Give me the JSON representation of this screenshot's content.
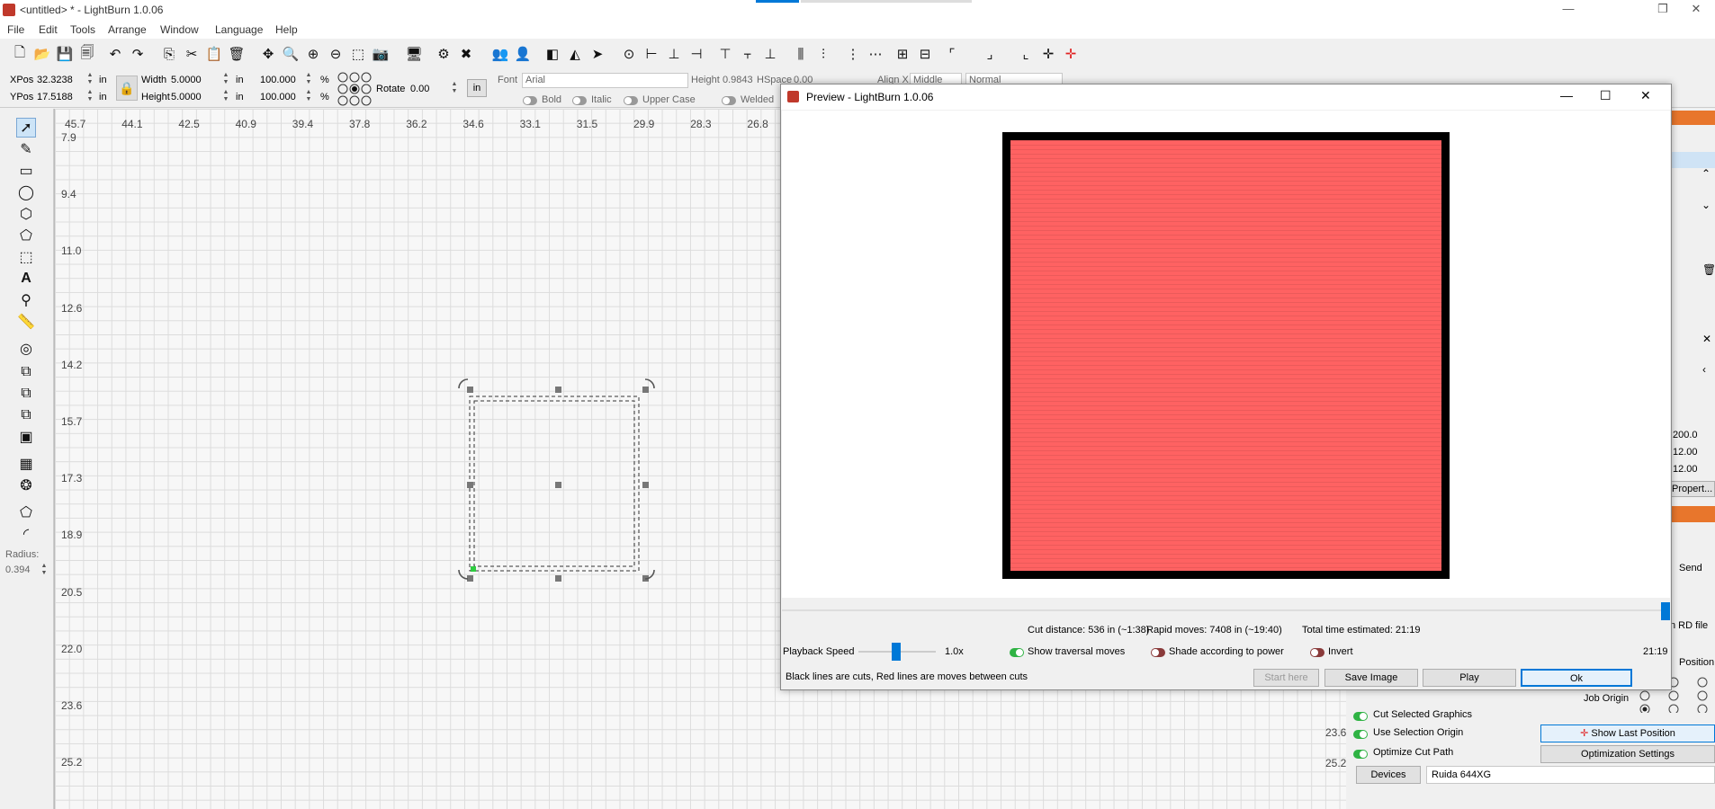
{
  "window": {
    "title": "<untitled> * - LightBurn 1.0.06",
    "minimize": "—",
    "restore": "❐",
    "close": "✕"
  },
  "menu": [
    "File",
    "Edit",
    "Tools",
    "Arrange",
    "Window",
    "Language",
    "Help"
  ],
  "props": {
    "xpos_label": "XPos",
    "xpos": "32.3238",
    "ypos_label": "YPos",
    "ypos": "17.5188",
    "unit": "in",
    "width_label": "Width",
    "width": "5.0000",
    "height_label": "Height",
    "height": "5.0000",
    "scale_w": "100.000",
    "scale_h": "100.000",
    "pct": "%",
    "rotate_label": "Rotate",
    "rotate": "0.00",
    "rotate_unit": "in",
    "font_label": "Font",
    "font": "Arial",
    "fheight_label": "Height",
    "fheight": "0.9843",
    "hspace_label": "HSpace",
    "hspace": "0.00",
    "alignx_label": "Align X",
    "alignx": "Middle",
    "normal": "Normal",
    "bold": "Bold",
    "italic": "Italic",
    "upper": "Upper Case",
    "welded": "Welded"
  },
  "radius": {
    "label": "Radius:",
    "value": "0.394"
  },
  "ruler_x": [
    "45.7",
    "44.1",
    "42.5",
    "40.9",
    "39.4",
    "37.8",
    "36.2",
    "34.6",
    "33.1",
    "31.5",
    "29.9",
    "28.3",
    "26.8"
  ],
  "ruler_y": [
    "7.9",
    "9.4",
    "11.0",
    "12.6",
    "14.2",
    "15.7",
    "17.3",
    "18.9",
    "20.5",
    "22.0",
    "23.6",
    "25.2"
  ],
  "ruler_y_right": [
    "23.6",
    "25.2"
  ],
  "preview": {
    "title": "Preview - LightBurn 1.0.06",
    "cut_distance": "Cut distance: 536 in (~1:38)",
    "rapid_moves": "Rapid moves: 7408 in (~19:40)",
    "total_time": "Total time estimated: 21:19",
    "playback_label": "Playback Speed",
    "speed": "1.0x",
    "traversal": "Show traversal moves",
    "shade": "Shade according to power",
    "invert": "Invert",
    "time": "21:19",
    "legend": "Black lines are cuts, Red lines are moves between cuts",
    "start_here": "Start here",
    "save_image": "Save Image",
    "play": "Play",
    "ok": "Ok",
    "progress": 1.0
  },
  "right": {
    "v1": "200.0",
    "v2": "12.00",
    "v3": "12.00",
    "properties": "Propert...",
    "send": "Send",
    "rd_file": "n RD file",
    "position": "Position",
    "job_origin": "Job Origin",
    "cut_selected": "Cut Selected Graphics",
    "use_selection": "Use Selection Origin",
    "optimize": "Optimize Cut Path",
    "show_last": "Show Last Position",
    "opt_settings": "Optimization Settings",
    "devices": "Devices",
    "device": "Ruida 644XG"
  },
  "colors": {
    "accent": "#0078d7",
    "toggle_on": "#2fb344",
    "toggle_off": "#8a3a3a",
    "preview_fill": "#ff6262"
  }
}
